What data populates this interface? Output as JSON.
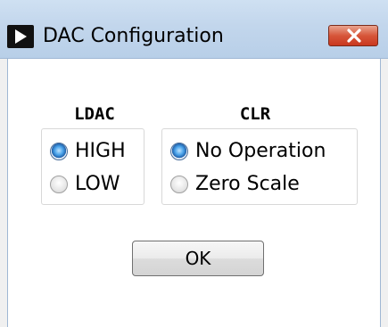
{
  "window": {
    "title": "DAC Configuration"
  },
  "icons": {
    "app": "play-triangle-icon",
    "close": "close-x-icon"
  },
  "ldac": {
    "title": "LDAC",
    "options": [
      {
        "label": "HIGH",
        "selected": true
      },
      {
        "label": "LOW",
        "selected": false
      }
    ]
  },
  "clr": {
    "title": "CLR",
    "options": [
      {
        "label": "No Operation",
        "selected": true
      },
      {
        "label": "Zero Scale",
        "selected": false
      }
    ]
  },
  "buttons": {
    "ok": "OK"
  },
  "colors": {
    "close_button": "#d7563a",
    "titlebar": "#c2d6ec",
    "radio_selected": "#1f5fa8"
  }
}
